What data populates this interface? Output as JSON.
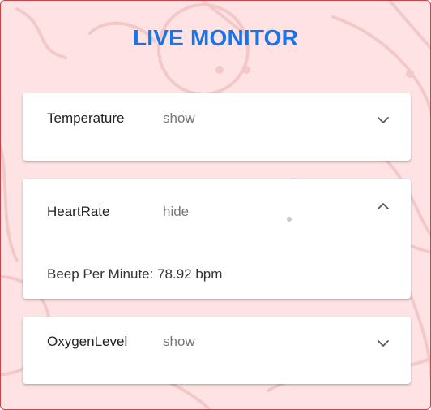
{
  "header": {
    "title": "LIVE MONITOR"
  },
  "cards": [
    {
      "name": "Temperature",
      "toggle": "show",
      "expanded": false,
      "icon": "chevron-down-icon"
    },
    {
      "name": "HeartRate",
      "toggle": "hide",
      "expanded": true,
      "icon": "chevron-up-icon",
      "value_text": "Beep Per Minute: 78.92 bpm"
    },
    {
      "name": "OxygenLevel",
      "toggle": "show",
      "expanded": false,
      "icon": "chevron-down-icon"
    }
  ],
  "colors": {
    "background": "#ffe3e4",
    "title": "#1a73e8",
    "card": "#ffffff",
    "border": "#c94545"
  }
}
